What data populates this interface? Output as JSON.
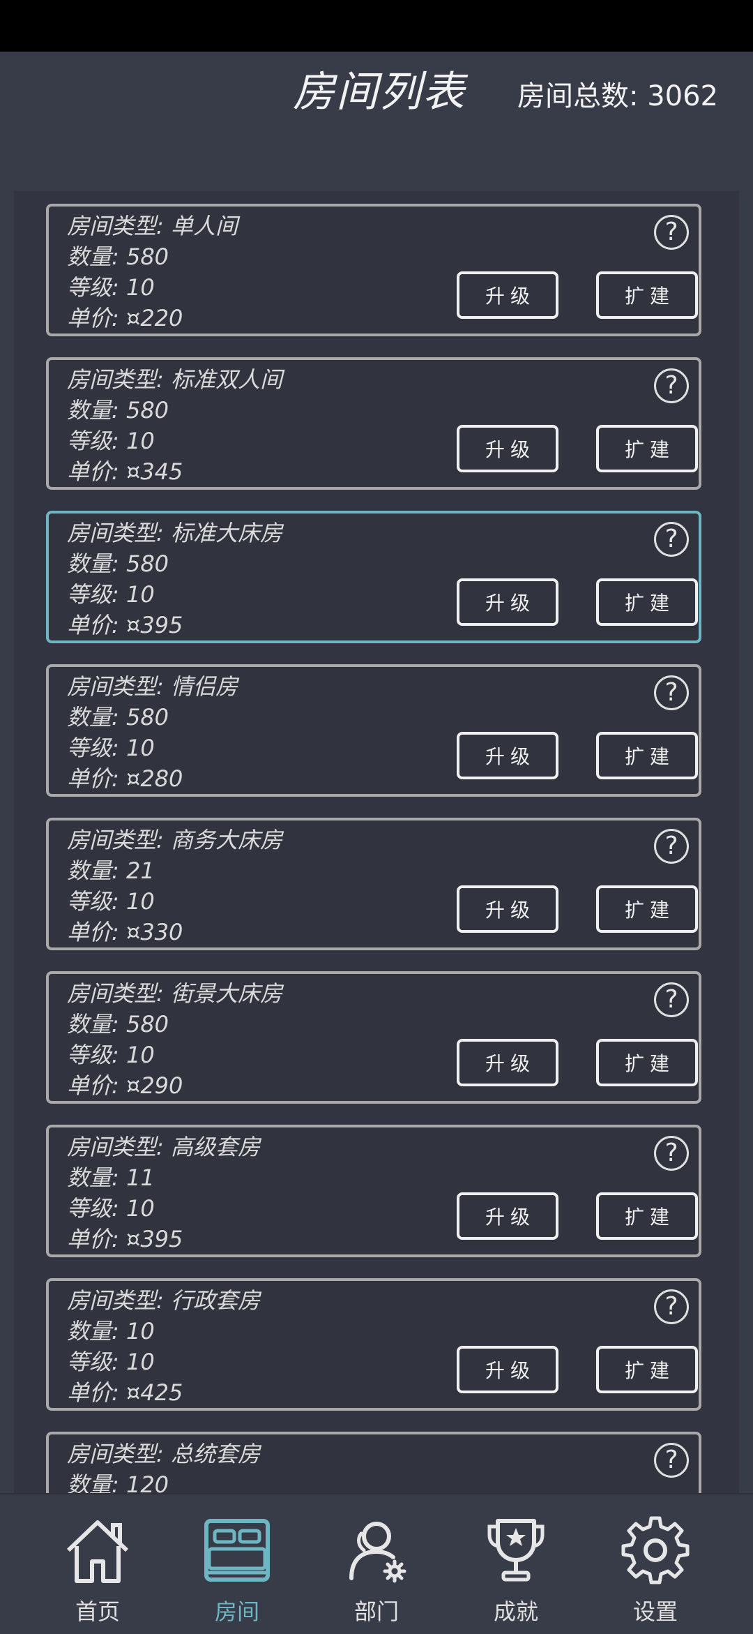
{
  "header": {
    "title": "房间列表",
    "total": "房间总数: 3062"
  },
  "room_cards": [
    {
      "type": "房间类型: 单人间",
      "count": "数量: 580",
      "level": "等级: 10",
      "price": "单价: ¤220",
      "help": "?",
      "upgrade": "升级",
      "expand": "扩建"
    },
    {
      "type": "房间类型: 标准双人间",
      "count": "数量: 580",
      "level": "等级: 10",
      "price": "单价: ¤345",
      "help": "?",
      "upgrade": "升级",
      "expand": "扩建"
    },
    {
      "type": "房间类型: 标准大床房",
      "count": "数量: 580",
      "level": "等级: 10",
      "price": "单价: ¤395",
      "help": "?",
      "upgrade": "升级",
      "expand": "扩建"
    },
    {
      "type": "房间类型: 情侣房",
      "count": "数量: 580",
      "level": "等级: 10",
      "price": "单价: ¤280",
      "help": "?",
      "upgrade": "升级",
      "expand": "扩建"
    },
    {
      "type": "房间类型: 商务大床房",
      "count": "数量: 21",
      "level": "等级: 10",
      "price": "单价: ¤330",
      "help": "?",
      "upgrade": "升级",
      "expand": "扩建"
    },
    {
      "type": "房间类型: 街景大床房",
      "count": "数量: 580",
      "level": "等级: 10",
      "price": "单价: ¤290",
      "help": "?",
      "upgrade": "升级",
      "expand": "扩建"
    },
    {
      "type": "房间类型: 高级套房",
      "count": "数量: 11",
      "level": "等级: 10",
      "price": "单价: ¤395",
      "help": "?",
      "upgrade": "升级",
      "expand": "扩建"
    },
    {
      "type": "房间类型: 行政套房",
      "count": "数量: 10",
      "level": "等级: 10",
      "price": "单价: ¤425",
      "help": "?",
      "upgrade": "升级",
      "expand": "扩建"
    },
    {
      "type": "房间类型: 总统套房",
      "count": "数量: 120",
      "level": "",
      "price": "",
      "help": "?",
      "upgrade": "",
      "expand": ""
    }
  ],
  "bottom_nav": {
    "items": [
      {
        "label": "首页",
        "icon": "home-icon"
      },
      {
        "label": "房间",
        "icon": "bed-icon",
        "active": true
      },
      {
        "label": "部门",
        "icon": "staff-icon"
      },
      {
        "label": "成就",
        "icon": "trophy-icon"
      },
      {
        "label": "设置",
        "icon": "gear-icon"
      }
    ]
  },
  "colors": {
    "accent": "#6fb6c4",
    "background": "#373c48",
    "panel": "#323541",
    "card_border": "#a9a9a9"
  }
}
